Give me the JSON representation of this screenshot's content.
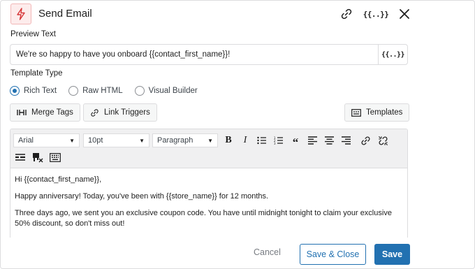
{
  "header": {
    "title": "Send Email",
    "icons": [
      "lightning-icon",
      "link-icon",
      "merge-tags-icon",
      "close-icon"
    ],
    "merge_label": "{{..}}"
  },
  "preview_text": {
    "label": "Preview Text",
    "value": "We're so happy to have you onboard {{contact_first_name}}!",
    "merge_label": "{{..}}"
  },
  "template_type": {
    "label": "Template Type",
    "options": [
      {
        "label": "Rich Text",
        "selected": true
      },
      {
        "label": "Raw HTML",
        "selected": false
      },
      {
        "label": "Visual Builder",
        "selected": false
      }
    ]
  },
  "actions": {
    "merge_tags": "Merge Tags",
    "link_triggers": "Link Triggers",
    "templates": "Templates"
  },
  "editor": {
    "font_family": "Arial",
    "font_size": "10pt",
    "block_format": "Paragraph",
    "content": [
      "Hi {{contact_first_name}},",
      "Happy anniversary! Today, you've been with {{store_name}} for 12 months.",
      "Three days ago, we sent you an exclusive coupon code. You have until midnight tonight to claim your exclusive 50% discount, so don't miss out!"
    ]
  },
  "footer": {
    "cancel": "Cancel",
    "save_close": "Save & Close",
    "save": "Save"
  },
  "colors": {
    "accent": "#2271b1",
    "icon_red": "#d63638"
  }
}
